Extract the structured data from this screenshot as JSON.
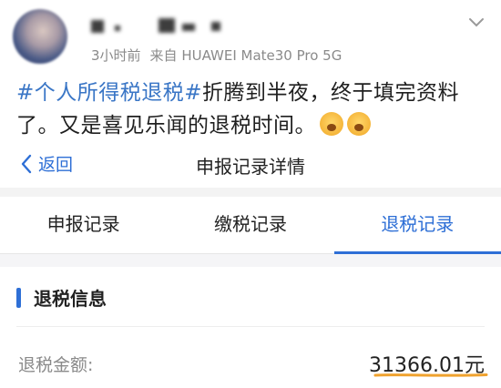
{
  "post": {
    "time": "3小时前",
    "device": "来自 HUAWEI Mate30 Pro 5G",
    "hashtag": "#个人所得税退税#",
    "line1_rest": "折腾到半夜，终于填完资料",
    "line2": "了。又是喜见乐闻的退税时间。"
  },
  "nav": {
    "back_label": "返回",
    "title": "申报记录详情"
  },
  "tabs": [
    {
      "label": "申报记录",
      "active": false
    },
    {
      "label": "缴税记录",
      "active": false
    },
    {
      "label": "退税记录",
      "active": true
    }
  ],
  "refund": {
    "section_title": "退税信息",
    "amount_label": "退税金额:",
    "amount_value": "31366.01元"
  },
  "colors": {
    "accent": "#2e6fd6",
    "hashtag": "#3a76c6",
    "highlight_underline": "#f0a22e"
  },
  "icons": {
    "back": "chevron-left-icon",
    "menu": "chevron-down-icon",
    "emoji": "moved-face-emoji"
  }
}
